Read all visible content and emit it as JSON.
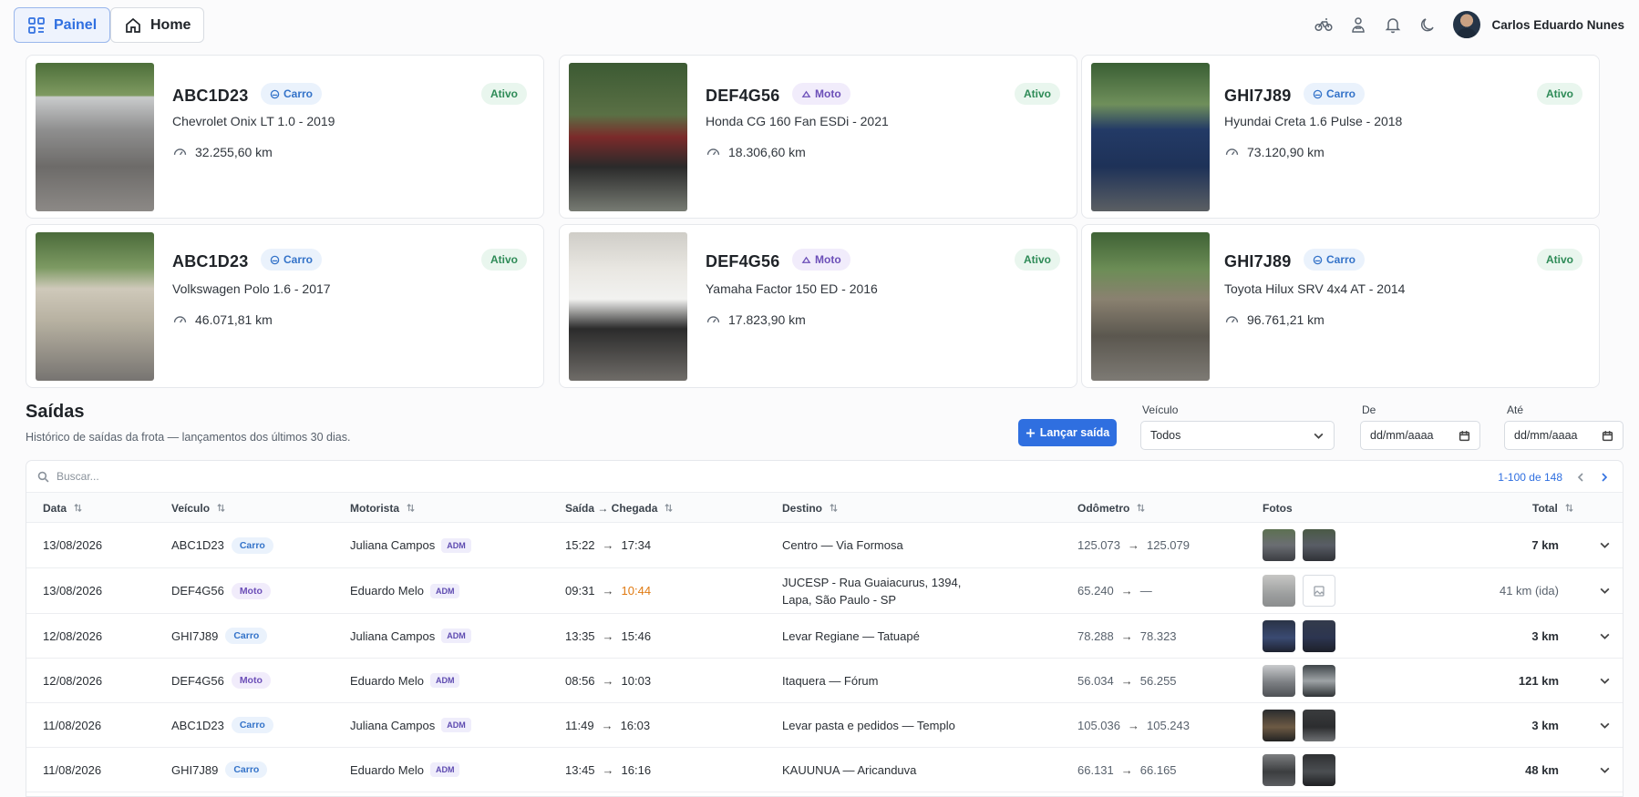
{
  "nav": {
    "dashboard_label": "Painel",
    "home_label": "Home"
  },
  "user": {
    "name": "Carlos Eduardo Nunes"
  },
  "vehicles": [
    {
      "plate": "ABC1D23",
      "type": "Carro",
      "status": "Ativo",
      "model": "Chevrolet Onix LT 1.0 - 2019",
      "km": "32.255,60 km"
    },
    {
      "plate": "DEF4G56",
      "type": "Moto",
      "status": "Ativo",
      "model": "Honda CG 160 Fan ESDi - 2021",
      "km": "18.306,60 km"
    },
    {
      "plate": "GHI7J89",
      "type": "Carro",
      "status": "Ativo",
      "model": "Hyundai Creta 1.6 Pulse - 2018",
      "km": "73.120,90 km"
    },
    {
      "plate": "ABC1D23",
      "type": "Carro",
      "status": "Ativo",
      "model": "Volkswagen Polo 1.6 - 2017",
      "km": "46.071,81 km"
    },
    {
      "plate": "DEF4G56",
      "type": "Moto",
      "status": "Ativo",
      "model": "Yamaha Factor 150 ED - 2016",
      "km": "17.823,90 km"
    },
    {
      "plate": "GHI7J89",
      "type": "Carro",
      "status": "Ativo",
      "model": "Toyota Hilux SRV 4x4 AT - 2014",
      "km": "96.761,21 km"
    }
  ],
  "trips": {
    "title": "Saídas",
    "subtitle": "Histórico de saídas da frota — lançamentos dos últimos 30 dias.",
    "add_label": "Lançar saída",
    "filters": {
      "vehicle_label": "Veículo",
      "vehicle_value": "Todos",
      "from_label": "De",
      "from_value": "dd/mm/aaaa",
      "to_label": "Até",
      "to_value": "dd/mm/aaaa"
    },
    "search_placeholder": "Buscar...",
    "pagination": "1-100 de 148",
    "columns": [
      "Data",
      "Veículo",
      "Motorista",
      "Saída → Chegada",
      "Destino",
      "Odômetro",
      "Fotos",
      "Total"
    ],
    "rows": [
      {
        "date": "13/08/2026",
        "plate": "ABC1D23",
        "type": "Carro",
        "driver": "Juliana Campos",
        "role": "ADM",
        "out": "15:22",
        "in": "17:34",
        "dest": "Centro — Via Formosa",
        "odo_start": "125.073",
        "odo_end": "125.079",
        "total": "7 km"
      },
      {
        "date": "13/08/2026",
        "plate": "DEF4G56",
        "type": "Moto",
        "driver": "Eduardo Melo",
        "role": "ADM",
        "out": "09:31",
        "in": "10:44",
        "dest": "JUCESP - Rua Guaiacurus, 1394, Lapa, São Paulo - SP",
        "odo_start": "65.240",
        "odo_end": "—",
        "total": "41 km (ida)"
      },
      {
        "date": "12/08/2026",
        "plate": "GHI7J89",
        "type": "Carro",
        "driver": "Juliana Campos",
        "role": "ADM",
        "out": "13:35",
        "in": "15:46",
        "dest": "Levar Regiane — Tatuapé",
        "odo_start": "78.288",
        "odo_end": "78.323",
        "total": "3 km"
      },
      {
        "date": "12/08/2026",
        "plate": "DEF4G56",
        "type": "Moto",
        "driver": "Eduardo Melo",
        "role": "ADM",
        "out": "08:56",
        "in": "10:03",
        "dest": "Itaquera — Fórum",
        "odo_start": "56.034",
        "odo_end": "56.255",
        "total": "121 km"
      },
      {
        "date": "11/08/2026",
        "plate": "ABC1D23",
        "type": "Carro",
        "driver": "Juliana Campos",
        "role": "ADM",
        "out": "11:49",
        "in": "16:03",
        "dest": "Levar pasta e pedidos — Templo",
        "odo_start": "105.036",
        "odo_end": "105.243",
        "total": "3 km"
      },
      {
        "date": "11/08/2026",
        "plate": "GHI7J89",
        "type": "Carro",
        "driver": "Eduardo Melo",
        "role": "ADM",
        "out": "13:45",
        "in": "16:16",
        "dest": "KAUUNUA — Aricanduva",
        "odo_start": "66.131",
        "odo_end": "66.165",
        "total": "48 km"
      }
    ]
  }
}
